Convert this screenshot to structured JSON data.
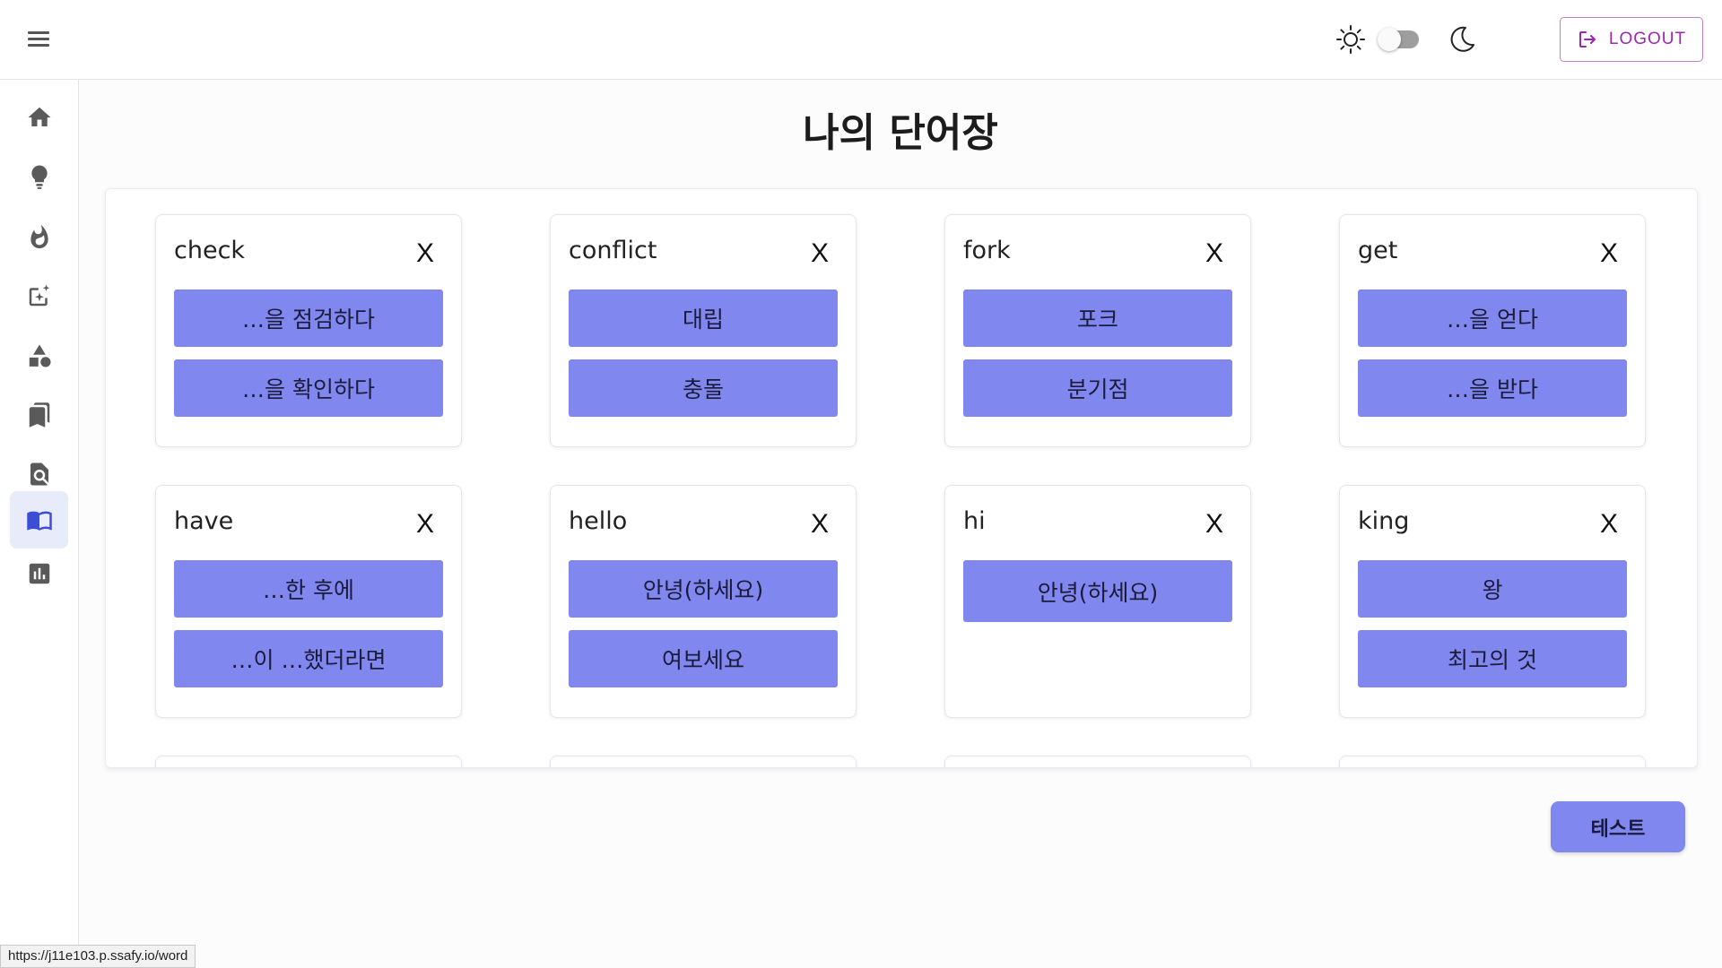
{
  "header": {
    "logout_label": "LOGOUT",
    "theme_toggle_on": false
  },
  "sidebar": {
    "items": [
      {
        "icon": "home-icon",
        "active": false
      },
      {
        "icon": "lightbulb-icon",
        "active": false
      },
      {
        "icon": "fire-icon",
        "active": false
      },
      {
        "icon": "note-sparkle-icon",
        "active": false
      },
      {
        "icon": "shapes-icon",
        "active": false
      },
      {
        "icon": "bookmarks-icon",
        "active": false
      },
      {
        "icon": "search-document-icon",
        "active": false
      },
      {
        "icon": "open-book-icon",
        "active": true
      },
      {
        "icon": "bar-chart-icon",
        "active": false
      }
    ]
  },
  "main": {
    "title": "나의 단어장",
    "cards": [
      {
        "word": "check",
        "close": "X",
        "meanings": [
          "…을 점검하다",
          "…을 확인하다"
        ]
      },
      {
        "word": "conflict",
        "close": "X",
        "meanings": [
          "대립",
          "충돌"
        ]
      },
      {
        "word": "fork",
        "close": "X",
        "meanings": [
          "포크",
          "분기점"
        ]
      },
      {
        "word": "get",
        "close": "X",
        "meanings": [
          "…을 얻다",
          "…을 받다"
        ]
      },
      {
        "word": "have",
        "close": "X",
        "meanings": [
          "…한 후에",
          "…이 …했더라면"
        ]
      },
      {
        "word": "hello",
        "close": "X",
        "meanings": [
          "안녕(하세요)",
          "여보세요"
        ]
      },
      {
        "word": "hi",
        "close": "X",
        "meanings": [
          "안녕(하세요)"
        ]
      },
      {
        "word": "king",
        "close": "X",
        "meanings": [
          "왕",
          "최고의 것"
        ]
      }
    ],
    "test_button": "테스트"
  },
  "status_bar": {
    "url": "https://j11e103.p.ssafy.io/word"
  },
  "colors": {
    "accent": "#8088ef",
    "logout": "#9c27b0",
    "active_nav_bg": "#e8ecfa",
    "nav_icon": "#5a5a5a",
    "active_nav_icon": "#3d4ed6"
  }
}
